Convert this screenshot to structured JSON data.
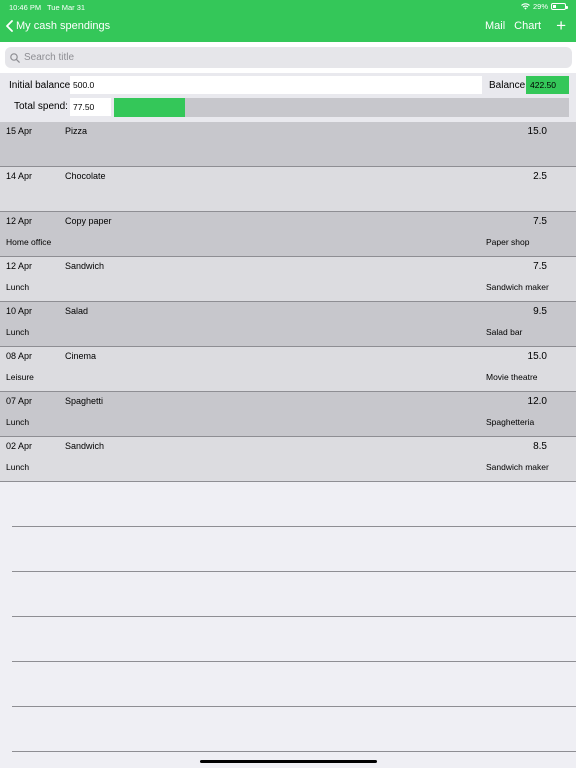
{
  "status_bar": {
    "time": "10:46 PM",
    "date": "Tue Mar 31",
    "battery": "29%"
  },
  "nav": {
    "back_label": "My cash spendings",
    "mail_label": "Mail",
    "chart_label": "Chart",
    "add_label": "+"
  },
  "search": {
    "placeholder": "Search title",
    "value": ""
  },
  "balance": {
    "initial_label": "Initial balance:",
    "initial_value": "500.0",
    "balance_label": "Balance:",
    "balance_value": "422.50",
    "total_label": "Total spend:",
    "total_value": "77.50",
    "spend_fraction": 0.155
  },
  "colors": {
    "accent": "#34c759",
    "row_dark": "#c7c7cc",
    "row_light": "#dcdce0"
  },
  "entries": [
    {
      "date": "15 Apr",
      "title": "Pizza",
      "amount": "15.0",
      "category": "",
      "shop": ""
    },
    {
      "date": "14 Apr",
      "title": "Chocolate",
      "amount": "2.5",
      "category": "",
      "shop": ""
    },
    {
      "date": "12 Apr",
      "title": "Copy paper",
      "amount": "7.5",
      "category": "Home office",
      "shop": "Paper shop"
    },
    {
      "date": "12 Apr",
      "title": "Sandwich",
      "amount": "7.5",
      "category": "Lunch",
      "shop": "Sandwich maker"
    },
    {
      "date": "10 Apr",
      "title": "Salad",
      "amount": "9.5",
      "category": "Lunch",
      "shop": "Salad bar"
    },
    {
      "date": "08 Apr",
      "title": "Cinema",
      "amount": "15.0",
      "category": "Leisure",
      "shop": "Movie theatre"
    },
    {
      "date": "07 Apr",
      "title": "Spaghetti",
      "amount": "12.0",
      "category": "Lunch",
      "shop": "Spaghetteria"
    },
    {
      "date": "02 Apr",
      "title": "Sandwich",
      "amount": "8.5",
      "category": "Lunch",
      "shop": "Sandwich maker"
    }
  ]
}
